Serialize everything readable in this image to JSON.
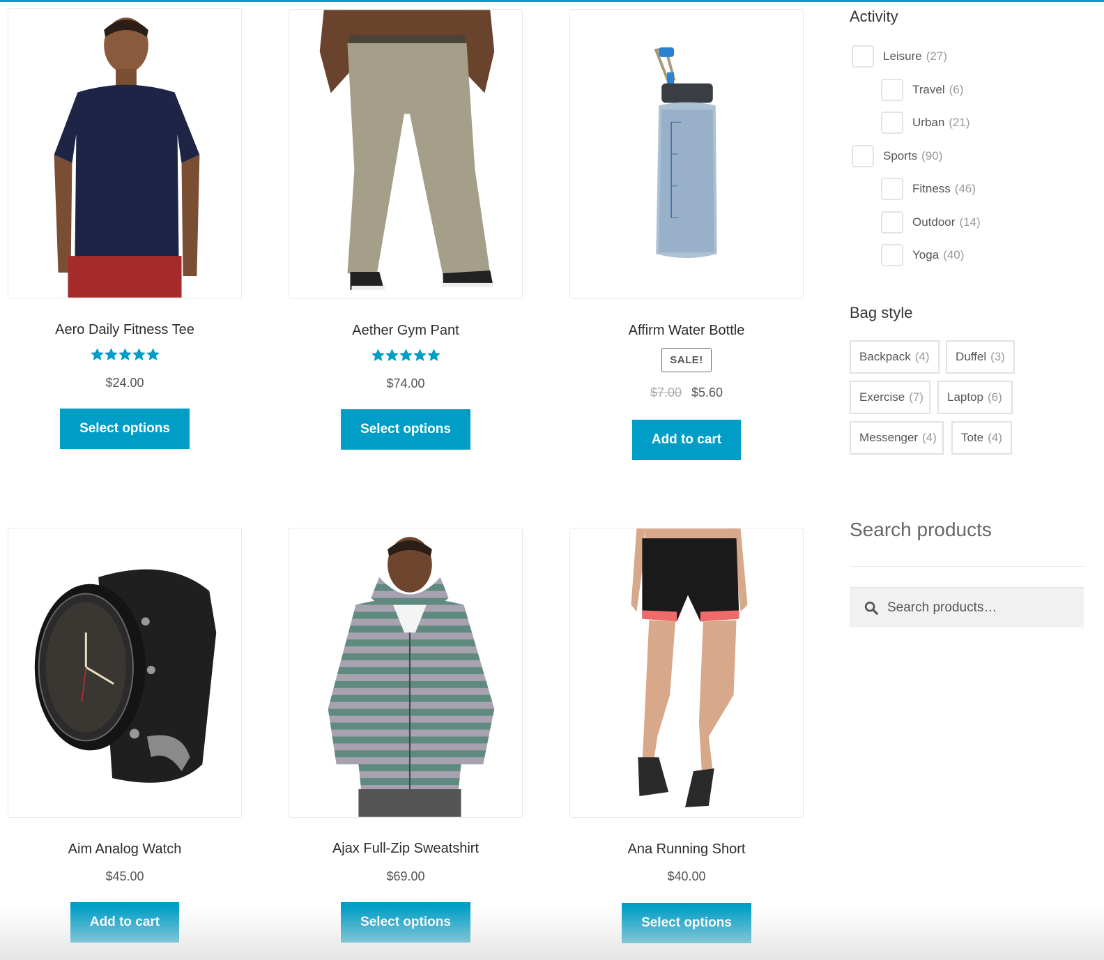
{
  "theme": {
    "accent": "#009ec6",
    "star": "#009ec6"
  },
  "products": [
    {
      "title": "Aero Daily Fitness Tee",
      "rating": 5,
      "rating_max": 5,
      "price": "$24.00",
      "button": "Select options",
      "image": "navy-tshirt"
    },
    {
      "title": "Aether Gym Pant",
      "rating": 5,
      "rating_max": 5,
      "price": "$74.00",
      "button": "Select options",
      "image": "khaki-cargo-pants"
    },
    {
      "title": "Affirm Water Bottle",
      "badge": "SALE!",
      "old_price": "$7.00",
      "price": "$5.60",
      "button": "Add to cart",
      "image": "blue-water-bottle"
    },
    {
      "title": "Aim Analog Watch",
      "price": "$45.00",
      "button": "Add to cart",
      "image": "black-analog-watch"
    },
    {
      "title": "Ajax Full-Zip Sweatshirt",
      "price": "$69.00",
      "button": "Select options",
      "image": "striped-zip-hoodie"
    },
    {
      "title": "Ana Running Short",
      "price": "$40.00",
      "button": "Select options",
      "image": "black-running-shorts"
    }
  ],
  "sidebar": {
    "activity": {
      "title": "Activity",
      "items": [
        {
          "label": "Leisure",
          "count": "(27)",
          "checked": false,
          "level": 0
        },
        {
          "label": "Travel",
          "count": "(6)",
          "checked": false,
          "level": 1
        },
        {
          "label": "Urban",
          "count": "(21)",
          "checked": false,
          "level": 1
        },
        {
          "label": "Sports",
          "count": "(90)",
          "checked": false,
          "level": 0
        },
        {
          "label": "Fitness",
          "count": "(46)",
          "checked": false,
          "level": 1
        },
        {
          "label": "Outdoor",
          "count": "(14)",
          "checked": false,
          "level": 1
        },
        {
          "label": "Yoga",
          "count": "(40)",
          "checked": false,
          "level": 1
        }
      ]
    },
    "bag_style": {
      "title": "Bag style",
      "tags": [
        {
          "label": "Backpack",
          "count": "(4)"
        },
        {
          "label": "Duffel",
          "count": "(3)"
        },
        {
          "label": "Exercise",
          "count": "(7)"
        },
        {
          "label": "Laptop",
          "count": "(6)"
        },
        {
          "label": "Messenger",
          "count": "(4)"
        },
        {
          "label": "Tote",
          "count": "(4)"
        }
      ]
    },
    "search": {
      "title": "Search products",
      "placeholder": "Search products…",
      "value": "",
      "icon": "search-icon"
    }
  }
}
